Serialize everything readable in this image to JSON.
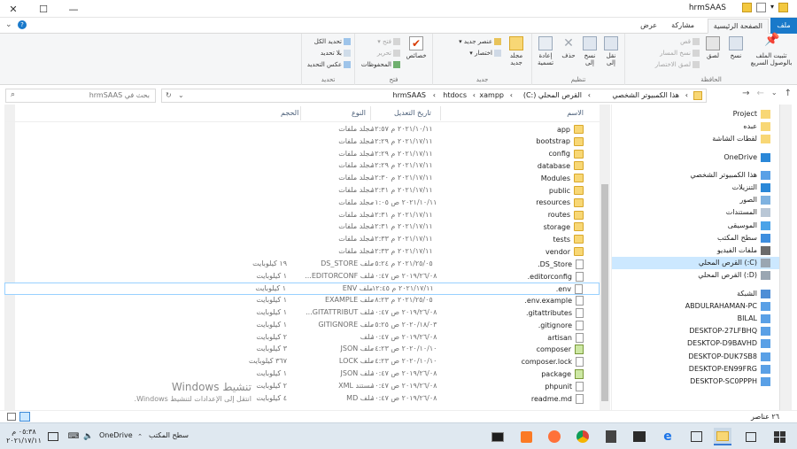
{
  "window": {
    "title": "hrmSAAS",
    "controls": {
      "close": "✕",
      "maximize": "☐",
      "minimize": "—"
    }
  },
  "tabs": {
    "file": "ملف",
    "home": "الصفحة الرئيسية",
    "share": "مشاركة",
    "view": "عرض"
  },
  "ribbon": {
    "clipboard": {
      "label": "الحافظة",
      "pin": "تثبيت الملف بالوصول السريع",
      "copy": "نسخ",
      "paste": "لصق",
      "cut": "قص",
      "copy_path": "نسخ المسار",
      "paste_shortcut": "لصق الاختصار"
    },
    "organize": {
      "label": "تنظيم",
      "move_to": "نقل إلى",
      "copy_to": "نسخ إلى",
      "delete": "حذف",
      "rename": "إعادة تسمية"
    },
    "new": {
      "label": "جديد",
      "new_folder": "مجلد جديد",
      "new_item": "عنصر جديد",
      "easy_access": "اختصار"
    },
    "open": {
      "label": "فتح",
      "properties": "خصائص",
      "open": "فتح",
      "edit": "تحرير",
      "history": "المحفوظات"
    },
    "select": {
      "label": "تحديد",
      "select_all": "تحديد الكل",
      "select_none": "بلا تحديد",
      "invert": "عكس التحديد"
    }
  },
  "address": {
    "crumbs": [
      "هذا الكمبيوتر الشخصي",
      "القرص المحلي (:C)",
      "xampp",
      "htdocs",
      "hrmSAAS"
    ],
    "search_placeholder": "بحث في hrmSAAS"
  },
  "nav": {
    "items": [
      {
        "label": "Project",
        "icon": "folder-icon"
      },
      {
        "label": "عبده",
        "icon": "folder-icon"
      },
      {
        "label": "لقطات الشاشة",
        "icon": "folder-icon"
      },
      {
        "label": "OneDrive",
        "icon": "cloud-icon"
      },
      {
        "label": "هذا الكمبيوتر الشخصي",
        "icon": "computer-icon"
      },
      {
        "label": "التنزيلات",
        "icon": "download-icon"
      },
      {
        "label": "الصور",
        "icon": "pictures-icon"
      },
      {
        "label": "المستندات",
        "icon": "documents-icon"
      },
      {
        "label": "الموسيقى",
        "icon": "music-icon"
      },
      {
        "label": "سطح المكتب",
        "icon": "desktop-icon"
      },
      {
        "label": "ملفات الفيديو",
        "icon": "video-icon"
      },
      {
        "label": "القرص المحلي (:C)",
        "icon": "drive-icon",
        "selected": true
      },
      {
        "label": "القرص المحلي (:D)",
        "icon": "drive-icon"
      },
      {
        "label": "الشبكة",
        "icon": "network-icon"
      },
      {
        "label": "ABDULRAHAMAN-PC",
        "icon": "computer-icon"
      },
      {
        "label": "BILAL",
        "icon": "computer-icon"
      },
      {
        "label": "DESKTOP-27LFBHQ",
        "icon": "computer-icon"
      },
      {
        "label": "DESKTOP-D9BAVHD",
        "icon": "computer-icon"
      },
      {
        "label": "DESKTOP-DUK7SB8",
        "icon": "computer-icon"
      },
      {
        "label": "DESKTOP-EN99FRG",
        "icon": "computer-icon"
      },
      {
        "label": "DESKTOP-SC0PPPH",
        "icon": "computer-icon"
      }
    ]
  },
  "columns": {
    "name": "الاسم",
    "date": "تاريخ التعديل",
    "type": "النوع",
    "size": "الحجم"
  },
  "files": [
    {
      "name": "app",
      "date": "٢٠٢١/١٠/١١ م ١٢:٥٧",
      "type": "مجلد ملفات",
      "size": "",
      "kind": "folder"
    },
    {
      "name": "bootstrap",
      "date": "٢٠٢١/١٧/١١ م ١٢:٢٩",
      "type": "مجلد ملفات",
      "size": "",
      "kind": "folder"
    },
    {
      "name": "config",
      "date": "٢٠٢١/١٧/١١ م ١٢:٢٩",
      "type": "مجلد ملفات",
      "size": "",
      "kind": "folder"
    },
    {
      "name": "database",
      "date": "٢٠٢١/١٧/١١ م ١٢:٢٩",
      "type": "مجلد ملفات",
      "size": "",
      "kind": "folder"
    },
    {
      "name": "Modules",
      "date": "٢٠٢١/١٧/١١ م ١٢:٣٠",
      "type": "مجلد ملفات",
      "size": "",
      "kind": "folder"
    },
    {
      "name": "public",
      "date": "٢٠٢١/١٧/١١ م ١٢:٣١",
      "type": "مجلد ملفات",
      "size": "",
      "kind": "folder"
    },
    {
      "name": "resources",
      "date": "٢٠٢١/١٠/١١ ص ٠١:٠٥",
      "type": "مجلد ملفات",
      "size": "",
      "kind": "folder"
    },
    {
      "name": "routes",
      "date": "٢٠٢١/١٧/١١ م ١٢:٣١",
      "type": "مجلد ملفات",
      "size": "",
      "kind": "folder"
    },
    {
      "name": "storage",
      "date": "٢٠٢١/١٧/١١ م ١٢:٣١",
      "type": "مجلد ملفات",
      "size": "",
      "kind": "folder"
    },
    {
      "name": "tests",
      "date": "٢٠٢١/١٧/١١ م ١٢:٣٣",
      "type": "مجلد ملفات",
      "size": "",
      "kind": "folder"
    },
    {
      "name": "vendor",
      "date": "٢٠٢١/١٧/١١ م ١٢:٣٣",
      "type": "مجلد ملفات",
      "size": "",
      "kind": "folder"
    },
    {
      "name": ".DS_Store",
      "date": "٢٠٢١/٢٥/٠٥ م ٠٥:٢٤",
      "type": "ملف DS_STORE",
      "size": "١٩ كيلوبايت",
      "kind": "file"
    },
    {
      "name": ".editorconfig",
      "date": "٢٠١٩/٢٦/٠٨ ص ١٠:٤٧",
      "type": "ملف EDITORCONF...",
      "size": "١ كيلوبايت",
      "kind": "file"
    },
    {
      "name": ".env",
      "date": "٢٠٢١/١٧/١١ م ١٢:٤٥",
      "type": "ملف ENV",
      "size": "١ كيلوبايت",
      "kind": "file",
      "selected": true
    },
    {
      "name": ".env.example",
      "date": "٢٠٢١/٢٥/٠٥ م ٠٨:٢٣",
      "type": "ملف EXAMPLE",
      "size": "١ كيلوبايت",
      "kind": "file"
    },
    {
      "name": ".gitattributes",
      "date": "٢٠١٩/٢٦/٠٨ ص ١٠:٤٧",
      "type": "ملف GITATTRIBUT...",
      "size": "١ كيلوبايت",
      "kind": "file"
    },
    {
      "name": ".gitignore",
      "date": "٢٠٢٠/١٨/٠٣ ص ٠٥:٢٥",
      "type": "ملف GITIGNORE",
      "size": "١ كيلوبايت",
      "kind": "file"
    },
    {
      "name": "artisan",
      "date": "٢٠١٩/٢٦/٠٨ ص ١٠:٤٧",
      "type": "ملف",
      "size": "٢ كيلوبايت",
      "kind": "file"
    },
    {
      "name": "composer",
      "date": "٢٠٢٠/١٠/١٠ ص ٠٤:٢٣",
      "type": "ملف JSON",
      "size": "٣ كيلوبايت",
      "kind": "comp"
    },
    {
      "name": "composer.lock",
      "date": "٢٠٢٠/١٠/١٠ ص ٠٤:٢٣",
      "type": "ملف LOCK",
      "size": "٣٦٧ كيلوبايت",
      "kind": "file"
    },
    {
      "name": "package",
      "date": "٢٠١٩/٢٦/٠٨ ص ١٠:٤٧",
      "type": "ملف JSON",
      "size": "١ كيلوبايت",
      "kind": "comp"
    },
    {
      "name": "phpunit",
      "date": "٢٠١٩/٢٦/٠٨ ص ١٠:٤٧",
      "type": "مستند XML",
      "size": "٢ كيلوبايت",
      "kind": "file"
    },
    {
      "name": "readme.md",
      "date": "٢٠١٩/٢٦/٠٨ ص ١٠:٤٧",
      "type": "ملف MD",
      "size": "٤ كيلوبايت",
      "kind": "file"
    }
  ],
  "status": {
    "count": "٢٦ عناصر"
  },
  "watermark": {
    "line1": "تنشيط Windows",
    "line2": "انتقل إلى الإعدادات لتنشيط Windows."
  },
  "taskbar": {
    "onedrive_label": "OneDrive",
    "desktop_label": "سطح المكتب",
    "time": "٠٥:٣٨ م",
    "date": "٢٠٢١/١٧/١١"
  }
}
